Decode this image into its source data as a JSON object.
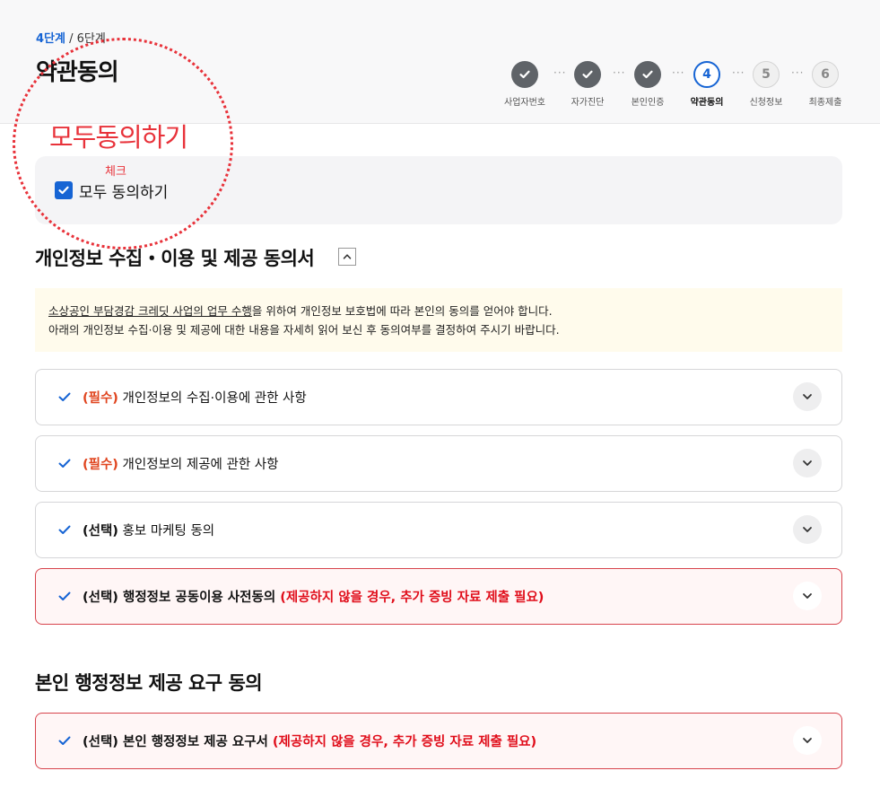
{
  "header": {
    "step_current": "4단계",
    "step_sep": " / ",
    "step_total": "6단계",
    "title": "약관동의"
  },
  "stepper": {
    "steps": [
      {
        "label": "사업자번호",
        "state": "done",
        "num": ""
      },
      {
        "label": "자가진단",
        "state": "done",
        "num": ""
      },
      {
        "label": "본인인증",
        "state": "done",
        "num": ""
      },
      {
        "label": "약관동의",
        "state": "active",
        "num": "4"
      },
      {
        "label": "신청정보",
        "state": "todo",
        "num": "5"
      },
      {
        "label": "최종제출",
        "state": "todo",
        "num": "6"
      }
    ],
    "separator": "···"
  },
  "agree_all": {
    "label": "모두 동의하기",
    "checked": true
  },
  "annotation": {
    "big_text": "모두동의하기",
    "small_text": "체크"
  },
  "section1": {
    "title": "개인정보 수집・이용 및 제공 동의서",
    "notice_underlined": "소상공인 부담경감 크레딧 사업의 업무 수행",
    "notice_line1_rest": "을 위하여 개인정보 보호법에 따라 본인의 동의를 얻어야 합니다.",
    "notice_line2": "아래의 개인정보 수집·이용 및 제공에 대한 내용을 자세히 읽어 보신 후 동의여부를 결정하여 주시기 바랍니다.",
    "items": [
      {
        "tag": "(필수)",
        "text": " 개인정보의 수집·이용에 관한 사항",
        "note": ""
      },
      {
        "tag": "(필수)",
        "text": " 개인정보의 제공에 관한 사항",
        "note": ""
      },
      {
        "tag": "(선택)",
        "text": " 홍보 마케팅 동의",
        "note": ""
      },
      {
        "tag": "(선택)",
        "text": " 행정정보 공동이용 사전동의 ",
        "note": "(제공하지 않을 경우, 추가 증빙 자료 제출 필요)"
      }
    ]
  },
  "section2": {
    "title": "본인 행정정보 제공 요구 동의",
    "items": [
      {
        "tag": "(선택)",
        "text": " 본인 행정정보 제공 요구서 ",
        "note": "(제공하지 않을 경우, 추가 증빙 자료 제출 필요)"
      }
    ]
  },
  "colors": {
    "primary": "#1664d4",
    "required": "#e0451f",
    "warning": "#e00d1a",
    "annotation": "#e8323a"
  }
}
